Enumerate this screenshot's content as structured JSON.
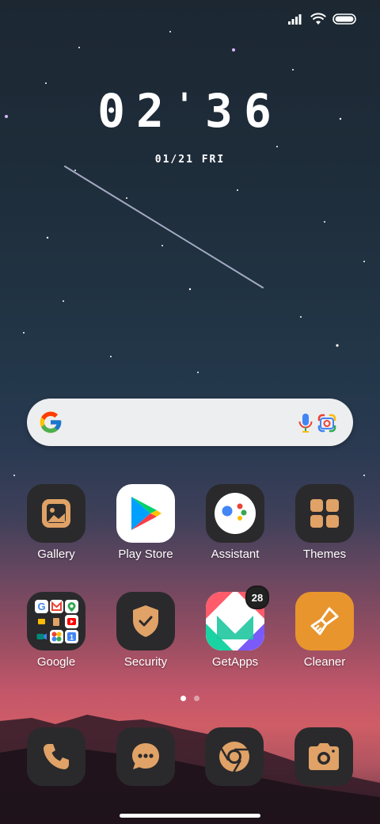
{
  "status_bar": {
    "signal_icon": "signal-icon",
    "wifi_icon": "wifi-icon",
    "battery_icon": "battery-icon"
  },
  "lockscreen_widget": {
    "time": "02:36",
    "hours": "02",
    "minutes": "36",
    "date": "01/21 FRI"
  },
  "search_bar": {
    "logo_icon": "google-g-icon",
    "mic_icon": "mic-icon",
    "lens_icon": "google-lens-icon"
  },
  "apps": [
    {
      "label": "Gallery",
      "icon": "gallery-icon"
    },
    {
      "label": "Play Store",
      "icon": "play-store-icon"
    },
    {
      "label": "Assistant",
      "icon": "assistant-icon"
    },
    {
      "label": "Themes",
      "icon": "themes-icon"
    },
    {
      "label": "Google",
      "icon": "google-folder-icon"
    },
    {
      "label": "Security",
      "icon": "security-shield-icon"
    },
    {
      "label": "GetApps",
      "icon": "getapps-icon",
      "badge": "28"
    },
    {
      "label": "Cleaner",
      "icon": "cleaner-brush-icon"
    }
  ],
  "page_indicator": {
    "pages": 2,
    "current": 1
  },
  "dock": [
    {
      "icon": "phone-icon"
    },
    {
      "icon": "messages-icon"
    },
    {
      "icon": "chrome-icon"
    },
    {
      "icon": "camera-icon"
    }
  ],
  "colors": {
    "accent": "#e0a266",
    "tile": "#2a2a2c",
    "search_bg": "#eceef0"
  }
}
